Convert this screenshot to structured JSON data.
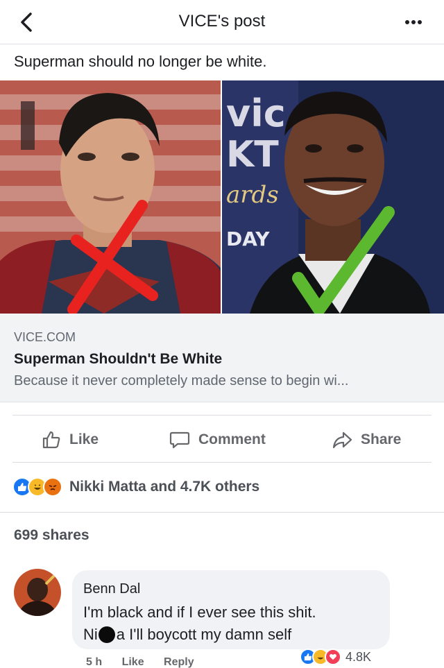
{
  "header": {
    "title": "VICE's post",
    "back_icon": "chevron-left-icon",
    "more_icon": "more-dots-icon"
  },
  "post": {
    "text": "Superman should no longer be white."
  },
  "images": {
    "left": "superman-red-x-photo",
    "right": "actor-green-check-photo"
  },
  "link_preview": {
    "domain": "VICE.COM",
    "title": "Superman Shouldn't Be White",
    "description": "Because it never completely made sense to begin wi..."
  },
  "actions": {
    "like": "Like",
    "comment": "Comment",
    "share": "Share"
  },
  "reactions": {
    "summary": "Nikki Matta and 4.7K others"
  },
  "shares": {
    "text": "699 shares"
  },
  "comment": {
    "author": "Benn Dal",
    "line1": "I'm black and if I ever see this shit.",
    "line2_start": "Ni",
    "line2_end": "a I'll boycott my damn self",
    "time": "5 h",
    "like": "Like",
    "reply": "Reply",
    "reaction_count": "4.8K"
  },
  "colors": {
    "like_blue": "#1877f2",
    "haha_yellow": "#f7b928",
    "angry_red": "#e9710f",
    "red_x": "#e8231f",
    "green_check": "#5cb82e"
  }
}
